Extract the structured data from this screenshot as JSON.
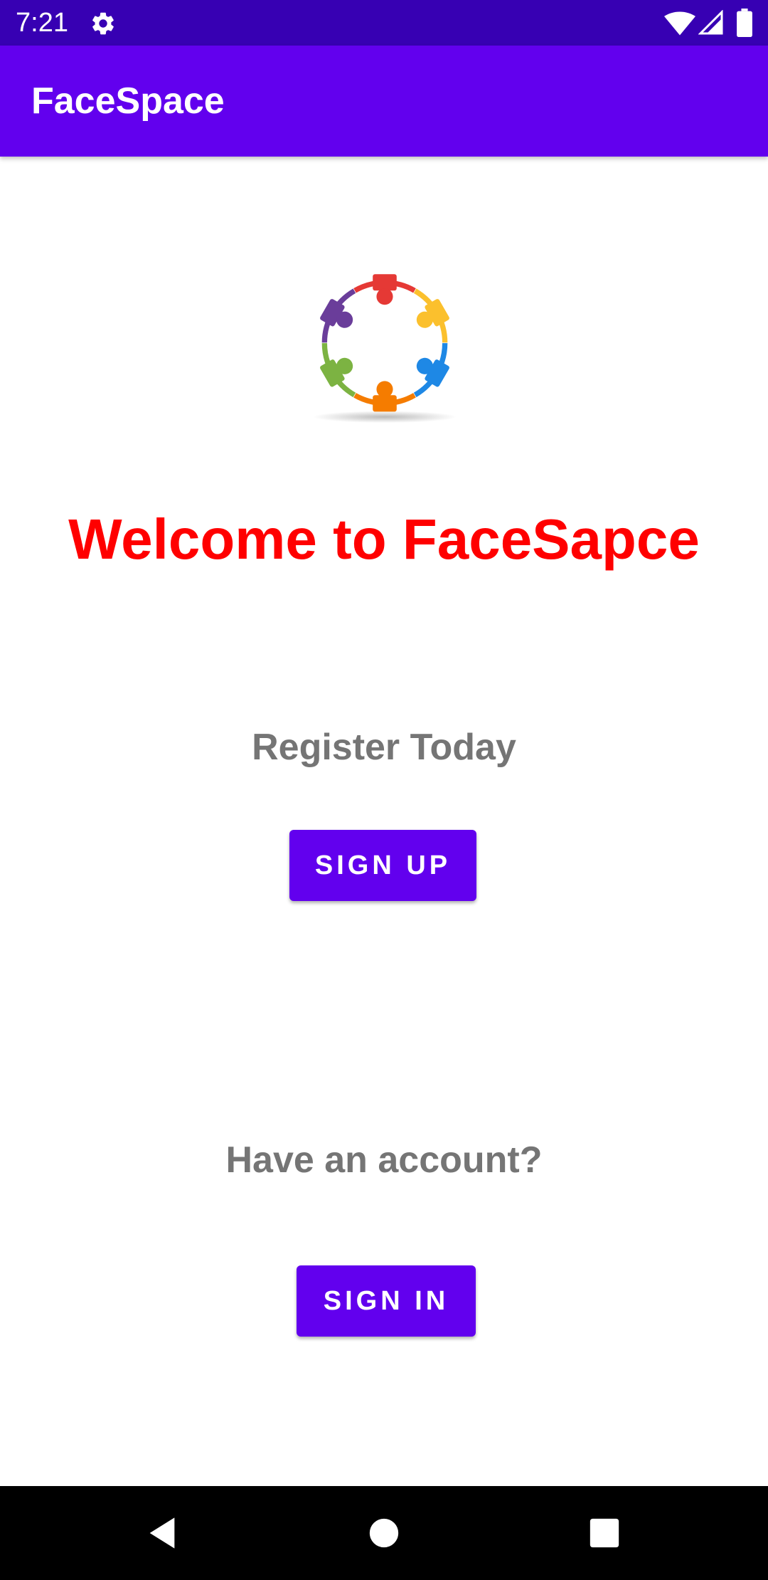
{
  "status_bar": {
    "time": "7:21",
    "icons": [
      "gear-icon",
      "wifi-icon",
      "signal-icon",
      "battery-icon"
    ]
  },
  "app_bar": {
    "title": "FaceSpace",
    "color": "#6200ee"
  },
  "logo": {
    "icon": "community-circle-logo",
    "colors": [
      "#e53935",
      "#fbc02d",
      "#1e88e5",
      "#f57c00",
      "#7cb342",
      "#6a3d9a"
    ]
  },
  "main": {
    "welcome_text": "Welcome to FaceSapce",
    "welcome_color": "#ff0000",
    "register_text": "Register Today",
    "signup_label": "SIGN UP",
    "have_account_text": "Have an account?",
    "signin_label": "SIGN IN"
  },
  "nav_bar": {
    "icons": [
      "back-icon",
      "home-icon",
      "recents-icon"
    ]
  }
}
